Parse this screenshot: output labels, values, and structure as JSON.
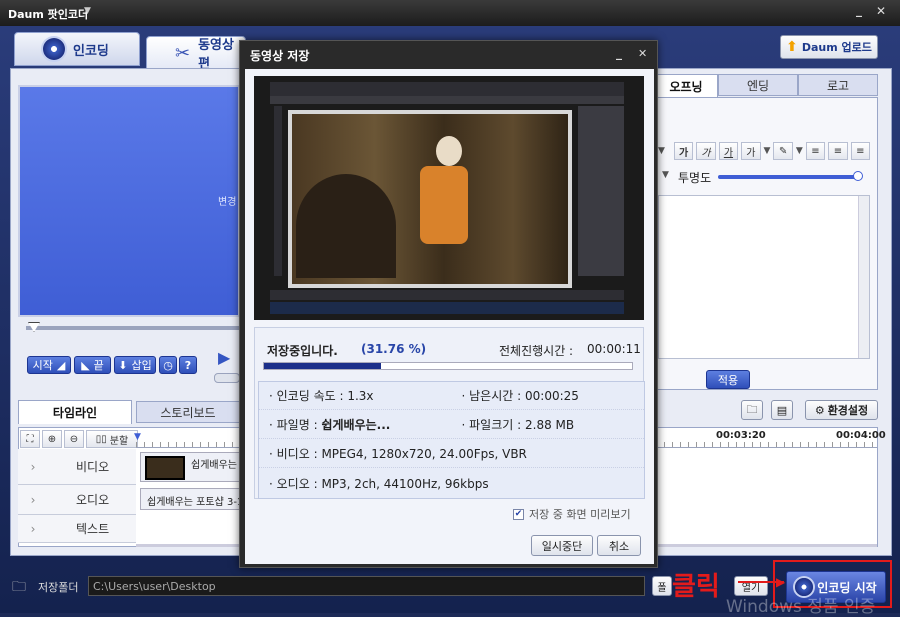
{
  "app": {
    "title": "Daum 팟인코더"
  },
  "tabs": {
    "encoding": "인코딩",
    "video_edit": "동영상 편"
  },
  "upload_button": "Daum 업로드",
  "right_tabs": [
    "오프닝",
    "엔딩",
    "로고"
  ],
  "toolbar_text": {
    "bold": "가",
    "italic": "가",
    "underline": "가",
    "shadow": "가"
  },
  "transparency_label": "투명도",
  "apply_button": "적용",
  "settings_button": "환경설정",
  "preview_caption": "변경",
  "edit_controls": {
    "start": "시작",
    "end": "끝",
    "insert": "삽입",
    "split": "분할"
  },
  "bottom_tabs": {
    "timeline": "타임라인",
    "storyboard": "스토리보드"
  },
  "timeline": {
    "ruler_marks": [
      "00:03:20",
      "00:04:00"
    ]
  },
  "tracks": [
    {
      "label": "비디오"
    },
    {
      "label": "오디오"
    },
    {
      "label": "텍스트"
    }
  ],
  "clips": {
    "video": "쉽게배우는",
    "audio": "쉽게배우는 포토샵 3-1"
  },
  "save_folder": {
    "label": "저장폴더",
    "path": "C:\\Users\\user\\Desktop"
  },
  "bottom_partial_buttons": {
    "open": "폴",
    "close": "열기"
  },
  "encode_start_button": "인코딩 시작",
  "annotation": {
    "text": "클릭",
    "color": "#e31b1b"
  },
  "watermark": "Windows 정품 인증",
  "dialog": {
    "title": "동영상 저장",
    "status": "저장중입니다.",
    "percent_text": "(31.76 %)",
    "progress": 0.3176,
    "total_time_label": "전체진행시간 :",
    "total_time": "00:00:11",
    "rows": [
      [
        {
          "label": "인코딩 속도 :",
          "value": "1.3x"
        },
        {
          "label": "남은시간 :",
          "value": "00:00:25"
        }
      ],
      [
        {
          "label": "파일명 :",
          "value": "쉽게배우는..."
        },
        {
          "label": "파일크기 :",
          "value": "2.88 MB"
        }
      ],
      [
        {
          "label": "비디오 :",
          "value": "MPEG4, 1280x720, 24.00Fps, VBR"
        }
      ],
      [
        {
          "label": "오디오 :",
          "value": "MP3, 2ch, 44100Hz, 96kbps"
        }
      ]
    ],
    "preview_checkbox": "저장 중 화면 미리보기",
    "preview_checked": true,
    "pause_button": "일시중단",
    "cancel_button": "취소"
  },
  "colors": {
    "accent": "#2f4fb9",
    "progress": "#1b2f8a"
  }
}
